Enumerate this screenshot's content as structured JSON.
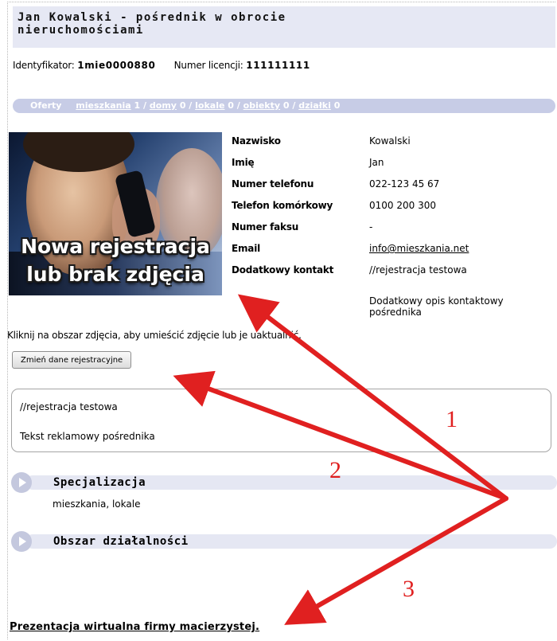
{
  "header": {
    "title_line1": "Jan Kowalski - pośrednik w obrocie",
    "title_line2": "nieruchomościami"
  },
  "ids": {
    "id_label": "Identyfikator:",
    "id_value": "1mie0000880",
    "license_label": "Numer licencji:",
    "license_value": "111111111"
  },
  "offers": {
    "label": "Oferty",
    "items": [
      {
        "name": "mieszkania",
        "count": "1"
      },
      {
        "name": "domy",
        "count": "0"
      },
      {
        "name": "lokale",
        "count": "0"
      },
      {
        "name": "obiekty",
        "count": "0"
      },
      {
        "name": "działki",
        "count": "0"
      }
    ],
    "sep": " / "
  },
  "photo": {
    "caption1": "Nowa rejestracja",
    "caption2": "lub brak zdjęcia"
  },
  "contact": [
    {
      "label": "Nazwisko",
      "value": "Kowalski"
    },
    {
      "label": "Imię",
      "value": "Jan"
    },
    {
      "label": "Numer telefonu",
      "value": "022-123 45 67"
    },
    {
      "label": "Telefon komórkowy",
      "value": "0100 200 300"
    },
    {
      "label": "Numer faksu",
      "value": "-"
    },
    {
      "label": "Email",
      "value": "info@mieszkania.net"
    },
    {
      "label": "Dodatkowy kontakt",
      "value": "//rejestracja testowa"
    }
  ],
  "extra_note": "Dodatkowy opis kontaktowy pośrednika",
  "photo_hint": "Kliknij na obszar zdjęcia, aby umieścić zdjęcie lub je uaktualnić.",
  "change_button": "Zmień dane rejestracyjne",
  "ad": {
    "line1": "//rejestracja testowa",
    "line2": "Tekst reklamowy pośrednika"
  },
  "sections": {
    "spec_title": "Specjalizacja",
    "spec_value": "mieszkania, lokale",
    "area_title": "Obszar działalności"
  },
  "bottom_link": "Prezentacja wirtualna firmy macierzystej.",
  "annotations": {
    "n1": "1",
    "n2": "2",
    "n3": "3",
    "arrow_color": "#e02020"
  }
}
